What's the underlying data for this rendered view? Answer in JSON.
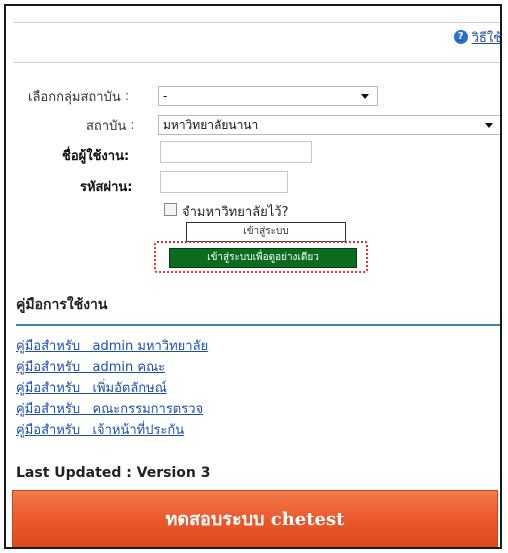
{
  "help": {
    "label": "วิธีใช้"
  },
  "login": {
    "group_label": "เลือกกลุ่มสถาบัน",
    "group_value": "-",
    "institution_label": "สถาบัน",
    "institution_value": "มหาวิทยาลัยนานา",
    "username_label": "ชื่อผู้ใช้งาน:",
    "username_value": "",
    "password_label": "รหัสผ่าน:",
    "password_value": "",
    "remember_label": "จำมหาวิทยาลัยไว้?",
    "login_button": "เข้าสู่ระบบ",
    "demo_button": "เข้าสู่ระบบเพื่อดูอย่างเดียว"
  },
  "manual": {
    "title": "คู่มือการใช้งาน",
    "links": [
      "คู่มือสำหรับ   admin มหาวิทยาลัย",
      "คู่มือสำหรับ   admin คณะ",
      "คู่มือสำหรับ   เพิ่มอัตลักษณ์",
      "คู่มือสำหรับ   คณะกรรมการตรวจ",
      "คู่มือสำหรับ   เจ้าหน้าที่ประกัน"
    ]
  },
  "footer": {
    "last_updated": "Last Updated : Version 3",
    "banner": "ทดสอบระบบ chetest"
  },
  "colors": {
    "demo_button_bg": "#0b6b1f",
    "highlight_border": "#d8323c",
    "banner_bg": "#e8562a",
    "link": "#1d4fb0"
  }
}
